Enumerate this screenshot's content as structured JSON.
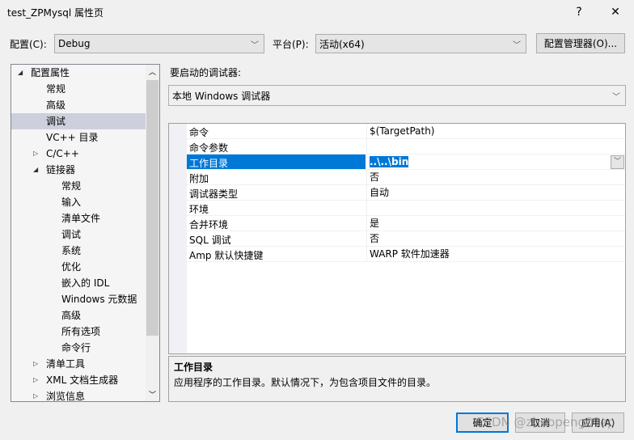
{
  "window": {
    "title": "test_ZPMysql 属性页",
    "help": "?",
    "close": "✕"
  },
  "config": {
    "label": "配置(C):",
    "value": "Debug",
    "platform_label": "平台(P):",
    "platform_value": "活动(x64)",
    "manager_button": "配置管理器(O)..."
  },
  "tree": {
    "items": [
      {
        "label": "配置属性",
        "level": 0,
        "state": "expanded"
      },
      {
        "label": "常规",
        "level": 1
      },
      {
        "label": "高级",
        "level": 1
      },
      {
        "label": "调试",
        "level": 1,
        "selected": true
      },
      {
        "label": "VC++ 目录",
        "level": 1
      },
      {
        "label": "C/C++",
        "level": 1,
        "state": "collapsed"
      },
      {
        "label": "链接器",
        "level": 1,
        "state": "expanded"
      },
      {
        "label": "常规",
        "level": 2
      },
      {
        "label": "输入",
        "level": 2
      },
      {
        "label": "清单文件",
        "level": 2
      },
      {
        "label": "调试",
        "level": 2
      },
      {
        "label": "系统",
        "level": 2
      },
      {
        "label": "优化",
        "level": 2
      },
      {
        "label": "嵌入的 IDL",
        "level": 2
      },
      {
        "label": "Windows 元数据",
        "level": 2
      },
      {
        "label": "高级",
        "level": 2
      },
      {
        "label": "所有选项",
        "level": 2
      },
      {
        "label": "命令行",
        "level": 2
      },
      {
        "label": "清单工具",
        "level": 1,
        "state": "collapsed"
      },
      {
        "label": "XML 文档生成器",
        "level": 1,
        "state": "collapsed"
      },
      {
        "label": "浏览信息",
        "level": 1,
        "state": "collapsed"
      }
    ]
  },
  "debugger": {
    "label": "要启动的调试器:",
    "value": "本地 Windows 调试器"
  },
  "properties": [
    {
      "name": "命令",
      "value": "$(TargetPath)"
    },
    {
      "name": "命令参数",
      "value": ""
    },
    {
      "name": "工作目录",
      "value": "..\\..\\bin",
      "selected": true
    },
    {
      "name": "附加",
      "value": "否"
    },
    {
      "name": "调试器类型",
      "value": "自动"
    },
    {
      "name": "环境",
      "value": ""
    },
    {
      "name": "合并环境",
      "value": "是"
    },
    {
      "name": "SQL 调试",
      "value": "否"
    },
    {
      "name": "Amp 默认快捷键",
      "value": "WARP 软件加速器"
    }
  ],
  "description": {
    "title": "工作目录",
    "text": "应用程序的工作目录。默认情况下，为包含项目文件的目录。"
  },
  "buttons": {
    "ok": "确定",
    "cancel": "取消",
    "apply": "应用(A)"
  },
  "watermark": "CSDN @zhaopeng01zp",
  "colors": {
    "selection": "#0078d7",
    "tree_selection": "#cdd0dc"
  }
}
